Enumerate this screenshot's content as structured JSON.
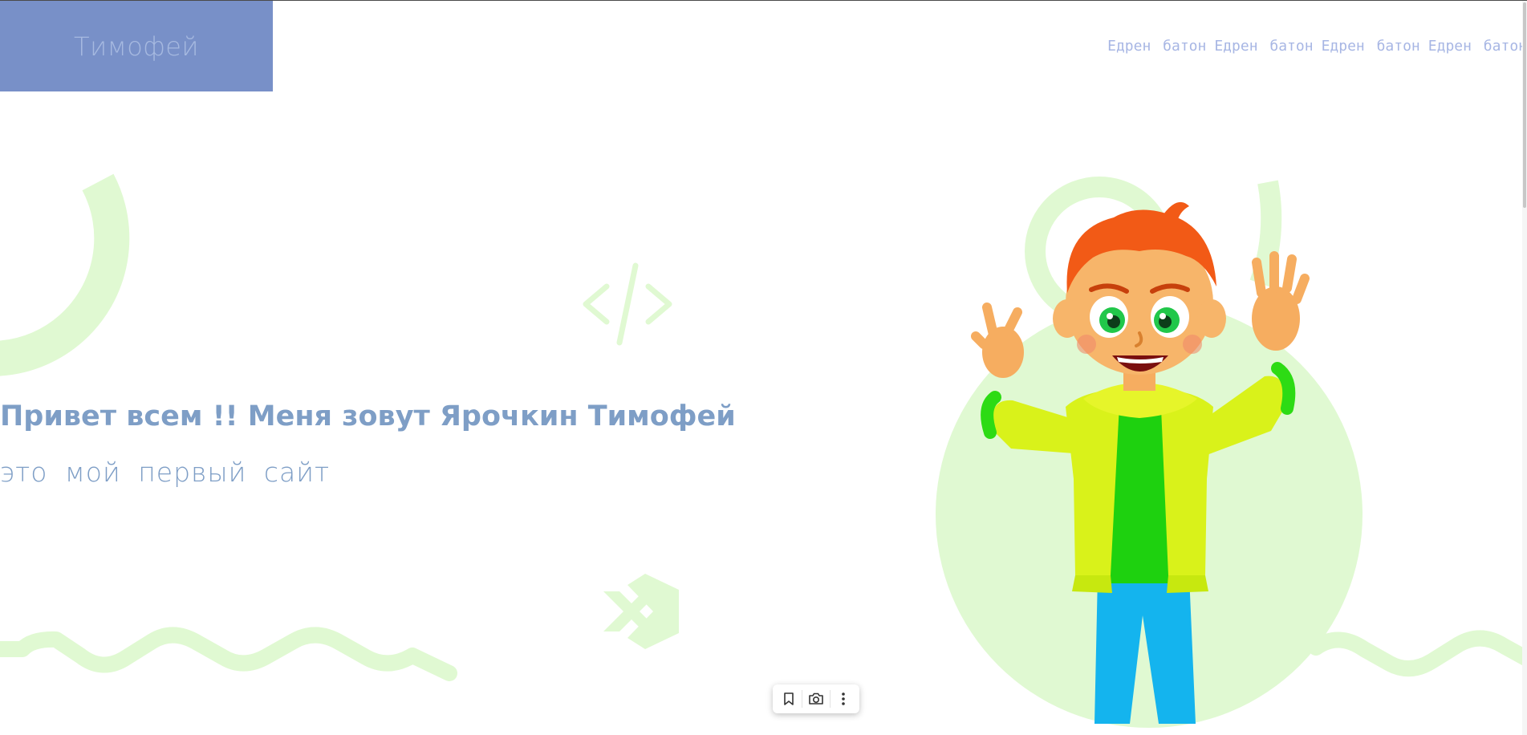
{
  "header": {
    "logo_text": "Тимофей",
    "nav_links": [
      "Едрен батон",
      "Едрен батон",
      "Едрен батон",
      "Едрен батон"
    ]
  },
  "hero": {
    "title": "Привет всем !! Меня зовут Ярочкин Тимофей",
    "subtitle": "это мой первый сайт",
    "illustration": "cartoon-boy-waving"
  },
  "floating_toolbar": {
    "buttons": [
      "bookmark-icon",
      "camera-icon",
      "more-vert-icon"
    ]
  },
  "colors": {
    "logo_bg": "#7890c8",
    "logo_text": "#a6b9e0",
    "nav_text": "#a7b6e4",
    "hero_text": "#7e9ec6",
    "decor_green": "#e0f9d2"
  }
}
